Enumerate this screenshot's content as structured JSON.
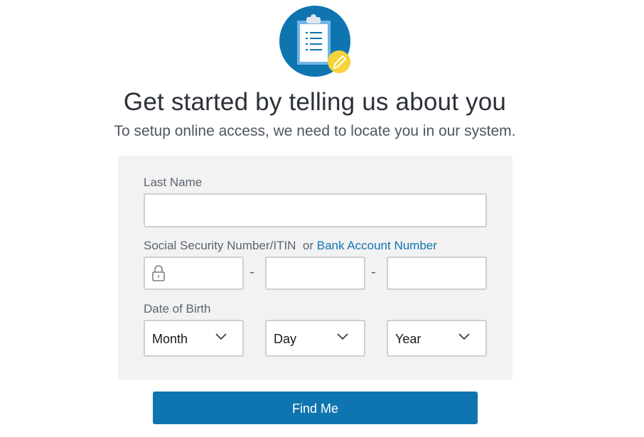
{
  "header": {
    "icon": "clipboard-edit-icon",
    "title": "Get started by telling us about you",
    "subtitle": "To setup online access, we need to locate you in our system."
  },
  "form": {
    "last_name": {
      "label": "Last Name",
      "value": "",
      "placeholder": ""
    },
    "ssn": {
      "label": "Social Security Number/ITIN",
      "or_text": "or",
      "alt_link": "Bank Account Number",
      "lock_icon": "lock-icon",
      "separator": "-",
      "part1": "",
      "part2": "",
      "part3": ""
    },
    "dob": {
      "label": "Date of Birth",
      "month": "Month",
      "day": "Day",
      "year": "Year"
    }
  },
  "actions": {
    "submit_label": "Find Me"
  },
  "colors": {
    "brand": "#0f75b0",
    "accent": "#f5d33a",
    "panel": "#f2f2f2"
  }
}
